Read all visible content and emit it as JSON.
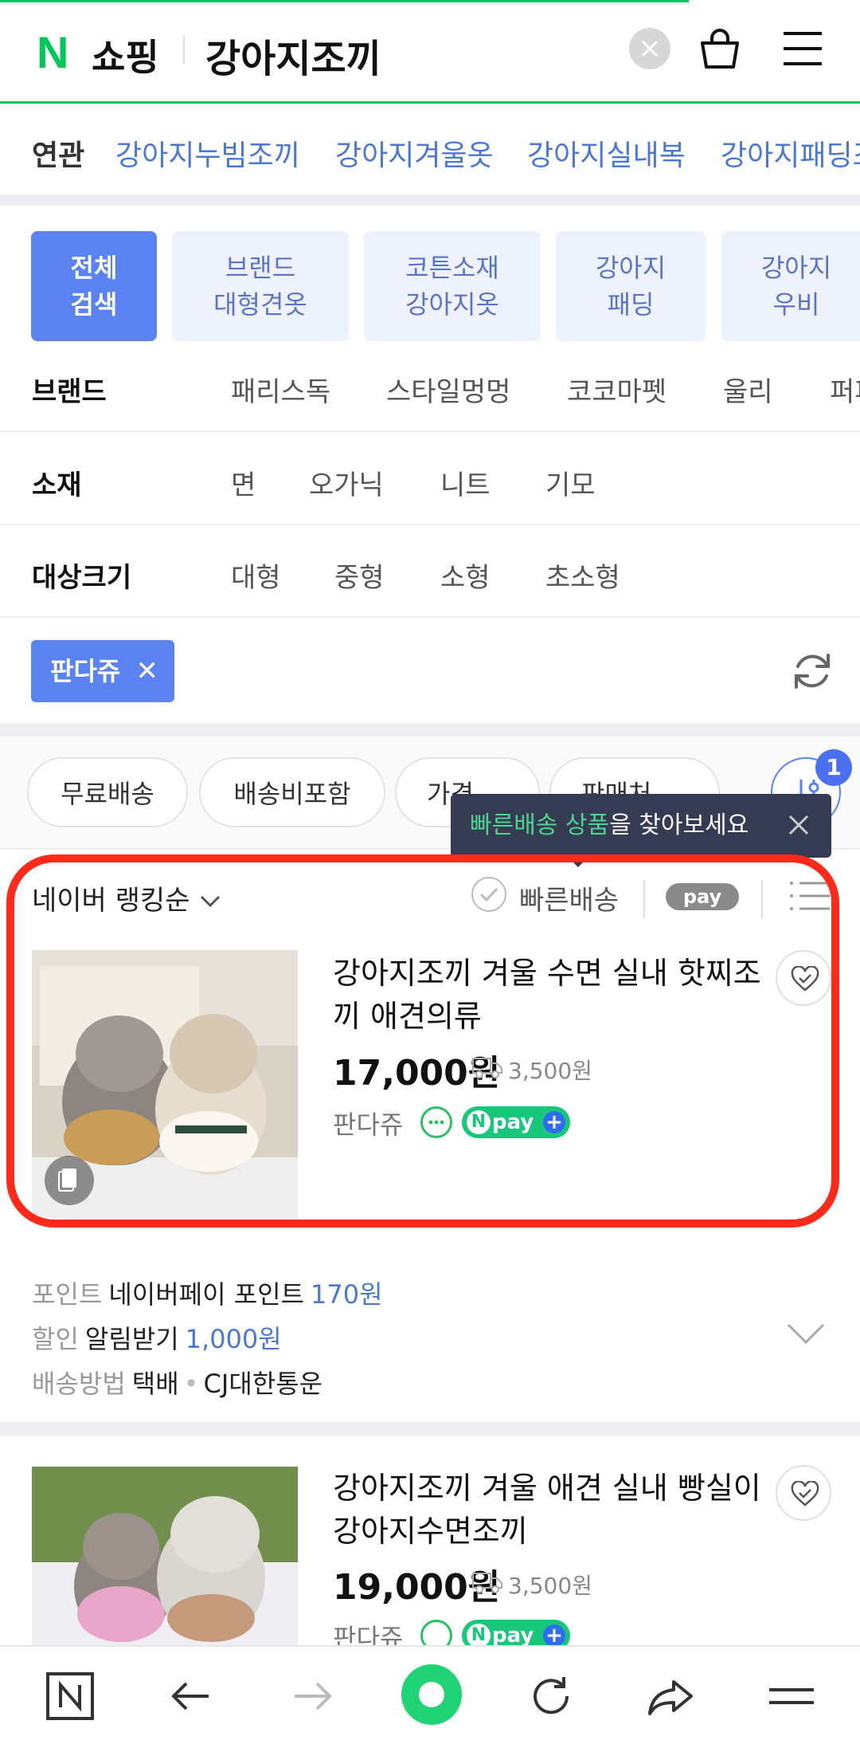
{
  "header": {
    "logo_n": "N",
    "logo_text": "쇼핑",
    "query": "강아지조끼",
    "icons": [
      "clear-icon",
      "cart-icon",
      "menu-icon"
    ]
  },
  "related": {
    "label": "연관",
    "keywords": [
      "강아지누빔조끼",
      "강아지겨울옷",
      "강아지실내복",
      "강아지패딩조끼"
    ]
  },
  "categories": [
    {
      "line1": "전체",
      "line2": "검색",
      "active": true
    },
    {
      "line1": "브랜드",
      "line2": "대형견옷",
      "active": false
    },
    {
      "line1": "코튼소재",
      "line2": "강아지옷",
      "active": false
    },
    {
      "line1": "강아지",
      "line2": "패딩",
      "active": false
    },
    {
      "line1": "강아지",
      "line2": "우비",
      "active": false
    }
  ],
  "filters": [
    {
      "label": "브랜드",
      "options": [
        "패리스독",
        "스타일멍멍",
        "코코마펫",
        "울리",
        "퍼피엔젤"
      ]
    },
    {
      "label": "소재",
      "options": [
        "면",
        "오가닉",
        "니트",
        "기모"
      ]
    },
    {
      "label": "대상크기",
      "options": [
        "대형",
        "중형",
        "소형",
        "초소형"
      ]
    }
  ],
  "selected_chip": {
    "label": "판다쥬",
    "close": "✕"
  },
  "pills": [
    "무료배송",
    "배송비포함",
    "가격",
    "판매처"
  ],
  "filter_badge": "1",
  "tooltip": {
    "highlight": "빠른배송 상품",
    "rest": "을 찾아보세요"
  },
  "sortbar": {
    "sort": "네이버 랭킹순",
    "fast": "빠른배송",
    "npay": "pay"
  },
  "products": [
    {
      "title": "강아지조끼 겨울 수면 실내 핫찌조끼 애견의류",
      "price": "17,000원",
      "shipping": "3,500원",
      "store": "판다쥬",
      "npay": "pay"
    },
    {
      "title": "강아지조끼 겨울 애견 실내 빵실이 강아지수면조끼",
      "price": "19,000원",
      "shipping": "3,500원",
      "store": "판다쥬",
      "npay": "pay"
    }
  ],
  "details": {
    "point_label": "포인트",
    "point_value": "네이버페이 포인트",
    "point_amount": "170원",
    "discount_label": "할인",
    "discount_value": "알림받기",
    "discount_amount": "1,000원",
    "delivery_label": "배송방법",
    "delivery_value": "택배",
    "delivery_carrier": "CJ대한통운"
  },
  "colors": {
    "accent_green": "#03c75a",
    "accent_blue": "#5a82f0",
    "highlight_red": "#ff2a1a"
  }
}
